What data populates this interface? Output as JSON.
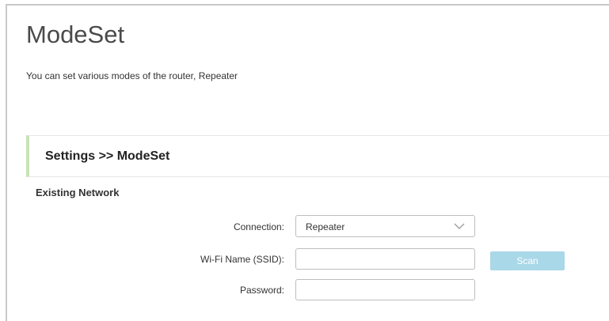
{
  "page": {
    "title": "ModeSet",
    "description": "You can set various modes of the router, Repeater"
  },
  "section": {
    "breadcrumb": "Settings >> ModeSet"
  },
  "existing_network": {
    "heading": "Existing Network",
    "connection": {
      "label": "Connection:",
      "value": "Repeater",
      "icon": "chevron-down-icon"
    },
    "ssid": {
      "label": "Wi-Fi Name (SSID):",
      "value": ""
    },
    "password": {
      "label": "Password:",
      "value": ""
    },
    "scan_label": "Scan"
  },
  "colors": {
    "accent_bar": "#c9e2b8",
    "scan_button": "#a9d8e8",
    "title_text": "#4a4a4a"
  }
}
